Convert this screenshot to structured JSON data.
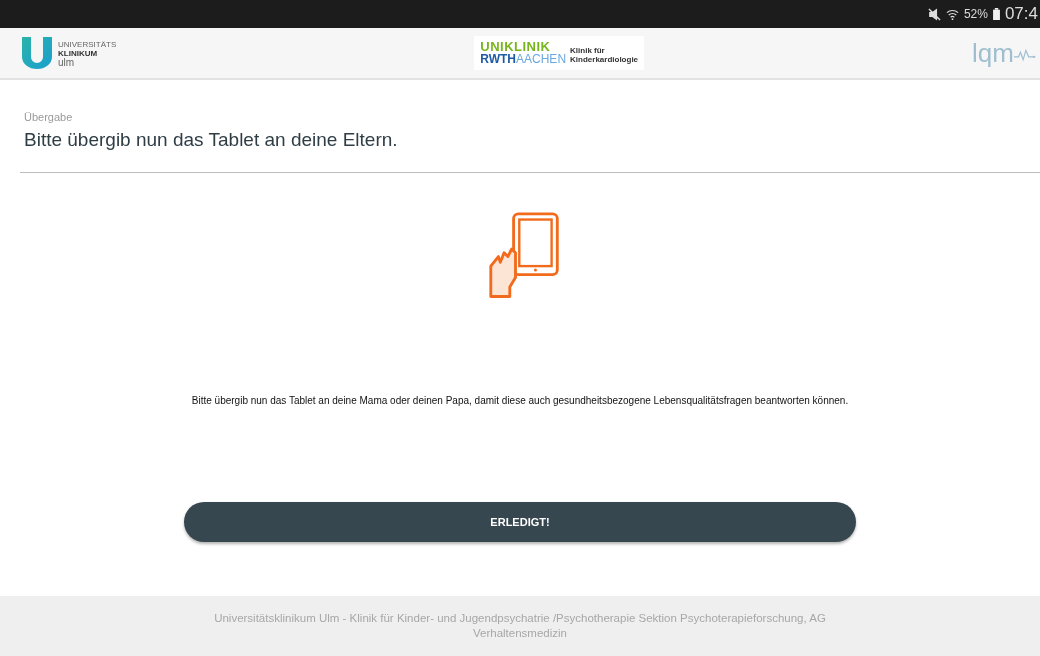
{
  "status_bar": {
    "battery": "52%",
    "time": "07:4"
  },
  "header": {
    "left_logo": [
      "UNIVERSITÄTS",
      "KLINIKUM",
      "ulm"
    ],
    "center_logo": {
      "line_1": "UNIKLINIK",
      "line_2a": "RWTH",
      "line_2b": "AACHEN",
      "caption": [
        "Klinik für",
        "Kinderkardiologie"
      ]
    },
    "right_logo": "lqm"
  },
  "section_label": "Übergabe",
  "title": "Bitte übergib nun das Tablet an deine Eltern.",
  "message": "Bitte übergib nun das Tablet an deine Mama oder deinen Papa, damit diese auch gesundheitsbezogene Lebensqualitätsfragen beantworten können.",
  "button": "ERLEDIGT!",
  "footer": "Universitätsklinikum Ulm - Klinik für Kinder- und Jugendpsychatrie /Psychotherapie Sektion Psychoterapieforschung, AG Verhaltensmedizin"
}
